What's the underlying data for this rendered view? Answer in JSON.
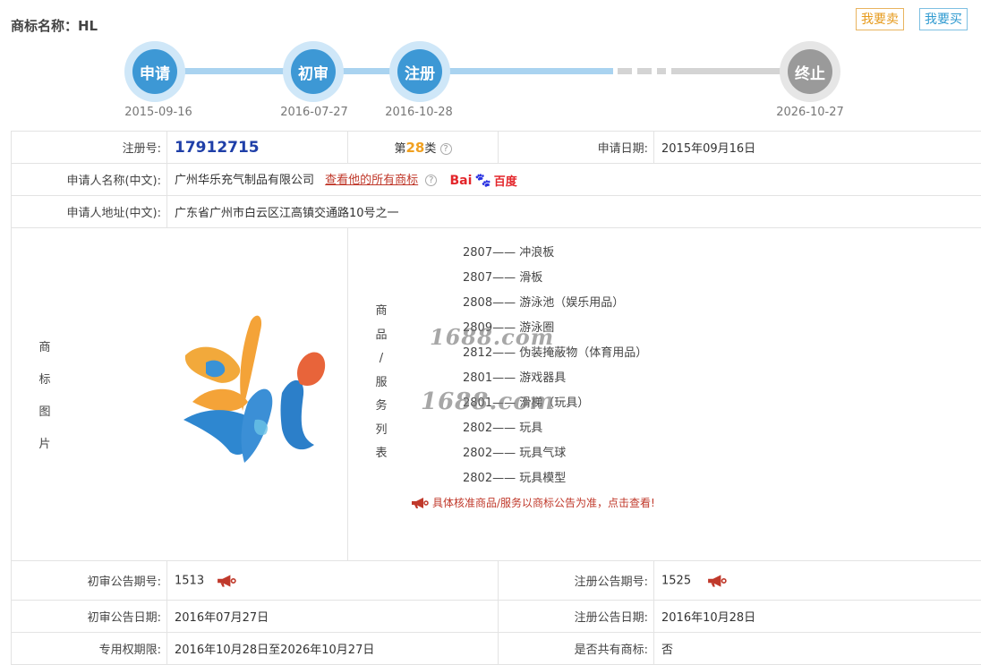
{
  "header": {
    "title": "商标名称：HL",
    "sell_label": "我要卖",
    "buy_label": "我要买"
  },
  "timeline": [
    {
      "label": "申请",
      "date": "2015-09-16"
    },
    {
      "label": "初审",
      "date": "2016-07-27"
    },
    {
      "label": "注册",
      "date": "2016-10-28"
    },
    {
      "label": "终止",
      "date": "2026-10-27"
    }
  ],
  "details": {
    "reg_no_label": "注册号:",
    "reg_no": "17912715",
    "class_prefix": "第",
    "class_num": "28",
    "class_suffix": "类",
    "apply_date_label": "申请日期:",
    "apply_date": "2015年09月16日",
    "applicant_name_label": "申请人名称(中文):",
    "applicant_name": "广州华乐充气制品有限公司",
    "all_marks_link": "查看他的所有商标",
    "baidu_bai": "Bai",
    "baidu_du": "百度",
    "applicant_addr_label": "申请人地址(中文):",
    "applicant_addr": "广东省广州市白云区江高镇交通路10号之一",
    "image_label": [
      "商",
      "标",
      "图",
      "片"
    ],
    "goods_label": [
      "商",
      "品",
      "/",
      "服",
      "务",
      "列",
      "表"
    ],
    "goods": [
      "2807—— 冲浪板",
      "2807—— 滑板",
      "2808—— 游泳池（娱乐用品）",
      "2809—— 游泳圈",
      "2812—— 伪装掩蔽物（体育用品）",
      "2801—— 游戏器具",
      "2801—— 滑梯（玩具）",
      "2802—— 玩具",
      "2802—— 玩具气球",
      "2802—— 玩具模型"
    ],
    "goods_note": "具体核准商品/服务以商标公告为准，点击查看!",
    "prelim_no_label": "初审公告期号:",
    "prelim_no": "1513",
    "reg_notice_no_label": "注册公告期号:",
    "reg_notice_no": "1525",
    "prelim_date_label": "初审公告日期:",
    "prelim_date": "2016年07月27日",
    "reg_notice_date_label": "注册公告日期:",
    "reg_notice_date": "2016年10月28日",
    "exclusive_label": "专用权期限:",
    "exclusive": "2016年10月28日至2026年10月27日",
    "shared_label": "是否共有商标:",
    "shared": "否"
  },
  "watermark": "1688.com",
  "colors": {
    "blue_node": "#3d98d5",
    "grey_node": "#9a9a9a",
    "reg_no": "#1f3fa8",
    "class_num": "#f0a020",
    "link": "#c0392b"
  }
}
